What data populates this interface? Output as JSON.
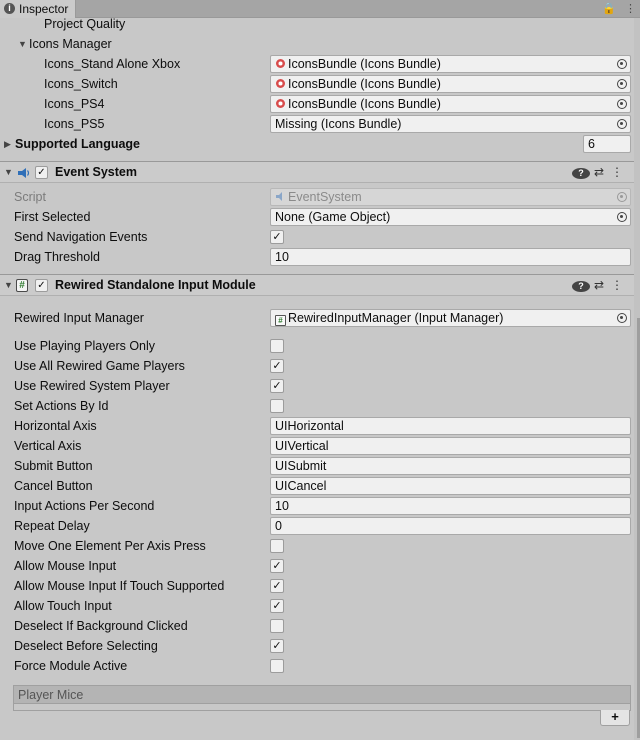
{
  "window": {
    "tab_title": "Inspector",
    "tab_icon": "info-icon"
  },
  "tab_tools": {
    "lock": "🔒",
    "menu": "⋮"
  },
  "settings": {
    "project_quality_label": "Project Quality",
    "icons_manager_label": "Icons Manager",
    "icons": [
      {
        "label": "Icons_Stand Alone Xbox",
        "value": "IconsBundle (Icons Bundle)"
      },
      {
        "label": "Icons_Switch",
        "value": "IconsBundle (Icons Bundle)"
      },
      {
        "label": "Icons_PS4",
        "value": "IconsBundle (Icons Bundle)"
      },
      {
        "label": "Icons_PS5",
        "value": "Missing (Icons Bundle)"
      }
    ],
    "supported_language_label": "Supported Language",
    "supported_language_count": "6"
  },
  "event_system": {
    "title": "Event System",
    "enabled": "✓",
    "script_label": "Script",
    "script_value": "EventSystem",
    "first_selected_label": "First Selected",
    "first_selected_value": "None (Game Object)",
    "send_nav_label": "Send Navigation Events",
    "send_nav_value": "✓",
    "drag_threshold_label": "Drag Threshold",
    "drag_threshold_value": "10"
  },
  "input_module": {
    "title": "Rewired Standalone Input Module",
    "enabled": "✓",
    "icon_glyph": "#",
    "rewired_input_manager_label": "Rewired Input Manager",
    "rewired_input_manager_value": "RewiredInputManager (Input Manager)",
    "rows": [
      {
        "label": "Use Playing Players Only",
        "type": "check",
        "value": ""
      },
      {
        "label": "Use All Rewired Game Players",
        "type": "check",
        "value": "✓"
      },
      {
        "label": "Use Rewired System Player",
        "type": "check",
        "value": "✓"
      },
      {
        "label": "Set Actions By Id",
        "type": "check",
        "value": ""
      },
      {
        "label": "Horizontal Axis",
        "type": "text",
        "value": "UIHorizontal"
      },
      {
        "label": "Vertical Axis",
        "type": "text",
        "value": "UIVertical"
      },
      {
        "label": "Submit Button",
        "type": "text",
        "value": "UISubmit"
      },
      {
        "label": "Cancel Button",
        "type": "text",
        "value": "UICancel"
      },
      {
        "label": "Input Actions Per Second",
        "type": "text",
        "value": "10"
      },
      {
        "label": "Repeat Delay",
        "type": "text",
        "value": "0"
      },
      {
        "label": "Move One Element Per Axis Press",
        "type": "check",
        "value": ""
      },
      {
        "label": "Allow Mouse Input",
        "type": "check",
        "value": "✓"
      },
      {
        "label": "Allow Mouse Input If Touch Supported",
        "type": "check",
        "value": "✓"
      },
      {
        "label": "Allow Touch Input",
        "type": "check",
        "value": "✓"
      },
      {
        "label": "Deselect If Background Clicked",
        "type": "check",
        "value": ""
      },
      {
        "label": "Deselect Before Selecting",
        "type": "check",
        "value": "✓"
      },
      {
        "label": "Force Module Active",
        "type": "check",
        "value": ""
      }
    ],
    "player_mice_label": "Player Mice",
    "add_label": "+"
  },
  "header_icons": {
    "help": "?",
    "presets": "⇄",
    "menu": "⋮"
  }
}
